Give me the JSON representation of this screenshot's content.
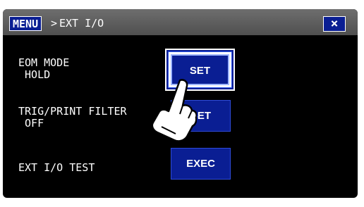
{
  "titlebar": {
    "menu_label": "MENU",
    "separator": ">",
    "title": "EXT I/O",
    "close_label": "×"
  },
  "rows": [
    {
      "label_line1": "EOM MODE",
      "label_line2": " HOLD",
      "button": "SET"
    },
    {
      "label_line1": "TRIG/PRINT FILTER",
      "label_line2": " OFF",
      "button": "SET"
    },
    {
      "label_line1": "EXT I/O TEST",
      "label_line2": "",
      "button": "EXEC"
    }
  ],
  "icons": {
    "pointer": "hand-pointer-icon"
  },
  "colors": {
    "button_blue": "#0a1e93",
    "background": "#000000",
    "titlebar": "#5a5a5a"
  }
}
